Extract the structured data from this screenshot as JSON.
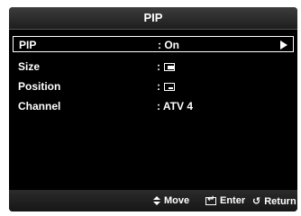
{
  "menu": {
    "title": "PIP",
    "rows": [
      {
        "label": "PIP",
        "value": ": On"
      },
      {
        "label": "Size",
        "value": ":"
      },
      {
        "label": "Position",
        "value": ":"
      },
      {
        "label": "Channel",
        "value": ": ATV 4"
      }
    ]
  },
  "footer": {
    "move_label": "Move",
    "enter_label": "Enter",
    "return_label": "Return"
  }
}
